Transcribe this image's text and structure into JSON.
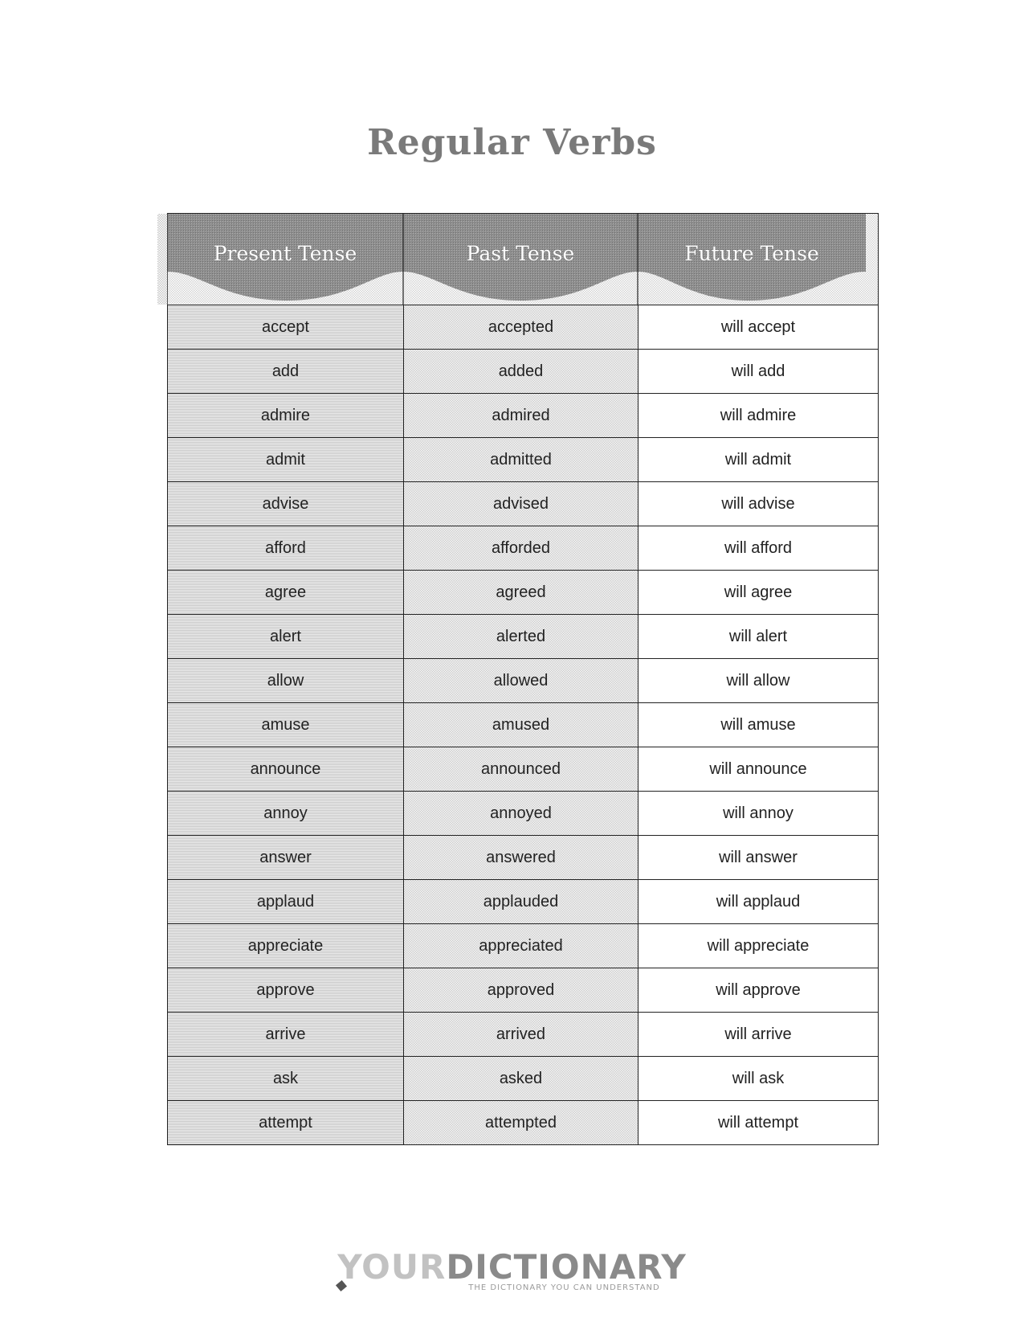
{
  "title": "Regular Verbs",
  "table": {
    "headers": [
      "Present Tense",
      "Past Tense",
      "Future Tense"
    ],
    "rows": [
      [
        "accept",
        "accepted",
        "will accept"
      ],
      [
        "add",
        "added",
        "will add"
      ],
      [
        "admire",
        "admired",
        "will admire"
      ],
      [
        "admit",
        "admitted",
        "will admit"
      ],
      [
        "advise",
        "advised",
        "will advise"
      ],
      [
        "afford",
        "afforded",
        "will afford"
      ],
      [
        "agree",
        "agreed",
        "will agree"
      ],
      [
        "alert",
        "alerted",
        "will alert"
      ],
      [
        "allow",
        "allowed",
        "will allow"
      ],
      [
        "amuse",
        "amused",
        "will amuse"
      ],
      [
        "announce",
        "announced",
        "will announce"
      ],
      [
        "annoy",
        "annoyed",
        "will annoy"
      ],
      [
        "answer",
        "answered",
        "will answer"
      ],
      [
        "applaud",
        "applauded",
        "will applaud"
      ],
      [
        "appreciate",
        "appreciated",
        "will appreciate"
      ],
      [
        "approve",
        "approved",
        "will approve"
      ],
      [
        "arrive",
        "arrived",
        "will arrive"
      ],
      [
        "ask",
        "asked",
        "will ask"
      ],
      [
        "attempt",
        "attempted",
        "will attempt"
      ]
    ]
  },
  "logo": {
    "part1": "YO",
    "part2": "UR",
    "part3": "DICTIONARY",
    "tagline": "THE DICTIONARY YOU CAN UNDERSTAND",
    "icon": "pen-icon"
  }
}
